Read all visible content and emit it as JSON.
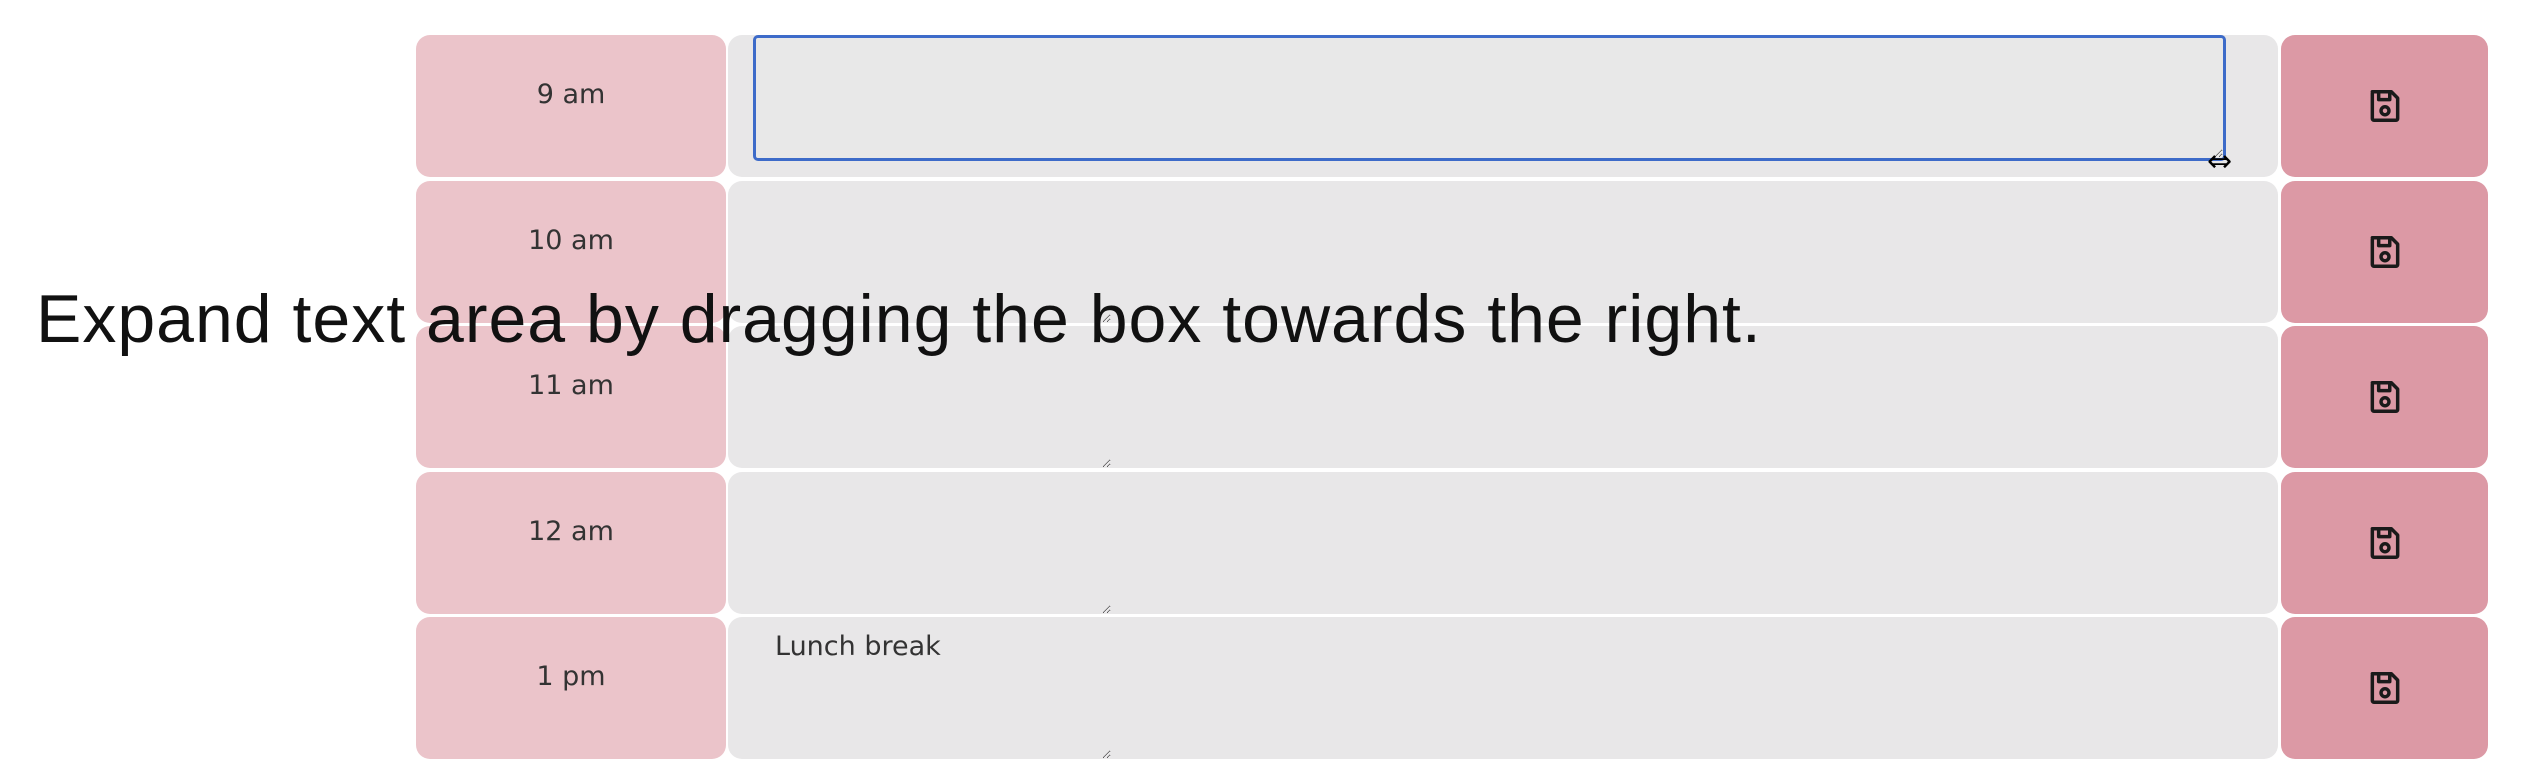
{
  "rows": [
    {
      "hour": "9 am",
      "text": ""
    },
    {
      "hour": "10 am",
      "text": ""
    },
    {
      "hour": "11 am",
      "text": ""
    },
    {
      "hour": "12 am",
      "text": ""
    },
    {
      "hour": "1 pm",
      "text": "Lunch break"
    }
  ],
  "caption": "Expand text area by dragging the box towards the right.",
  "save_icon": "floppy-disk-icon",
  "colors": {
    "hour_bg": "#ebc4ca",
    "save_bg": "#dc99a5",
    "textarea_bg": "#e8e7e8",
    "focus": "#3d6bc9"
  }
}
